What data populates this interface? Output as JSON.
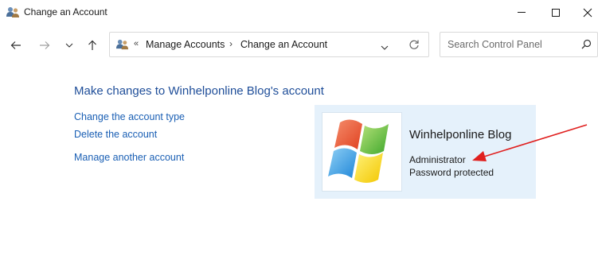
{
  "window": {
    "title": "Change an Account"
  },
  "address_bar": {
    "overflow_chevron": "«",
    "breadcrumbs": [
      "Manage Accounts",
      "Change an Account"
    ],
    "separator": "›"
  },
  "search": {
    "placeholder": "Search Control Panel"
  },
  "main": {
    "heading": "Make changes to Winhelponline Blog's account",
    "tasks": [
      "Change the account type",
      "Delete the account",
      "Manage another account"
    ]
  },
  "account": {
    "name": "Winhelponline Blog",
    "type": "Administrator",
    "password_status": "Password protected"
  },
  "colors": {
    "link": "#1a5fb4",
    "heading": "#1f4e99",
    "card_background": "#e5f1fb",
    "annotation_arrow": "#e0201f"
  },
  "icons": [
    "users-icon",
    "minimize-icon",
    "maximize-icon",
    "close-icon",
    "back-arrow-icon",
    "forward-arrow-icon",
    "recent-chevron-icon",
    "up-arrow-icon",
    "dropdown-chevron-icon",
    "refresh-icon",
    "search-icon",
    "windows-logo-icon"
  ]
}
